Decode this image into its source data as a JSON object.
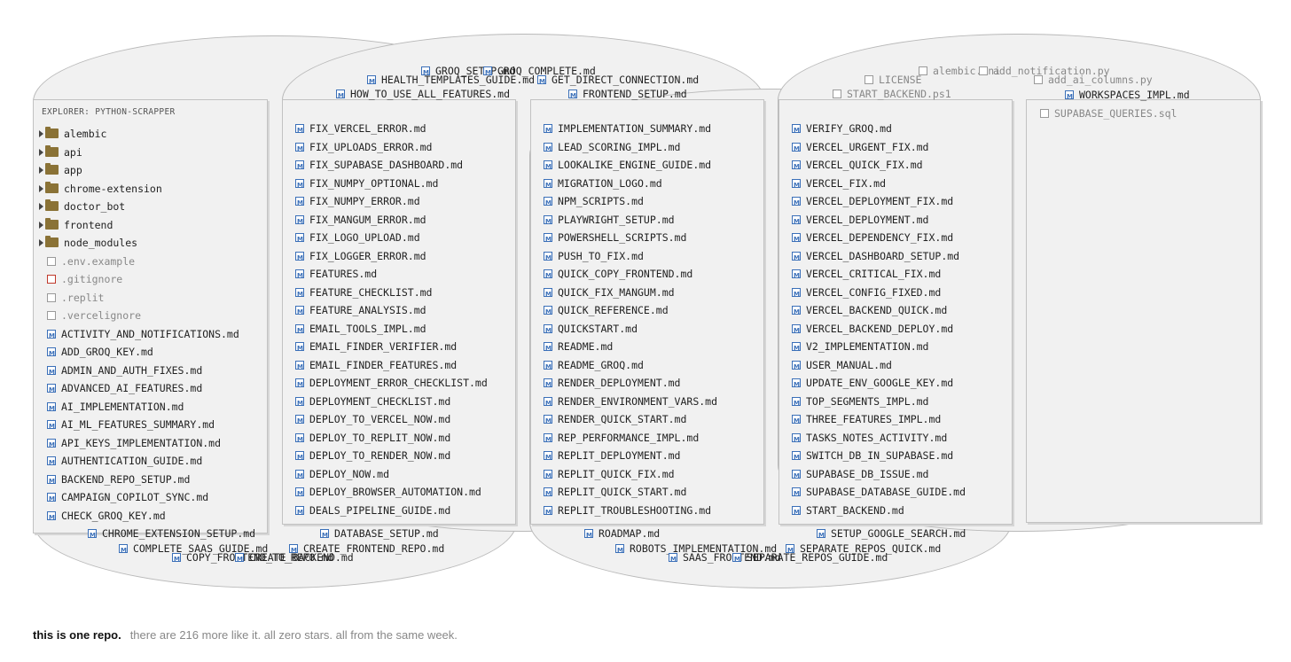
{
  "explorer": {
    "title": "EXPLORER: PYTHON-SCRAPPER",
    "entries": [
      {
        "t": "folder",
        "label": "alembic"
      },
      {
        "t": "folder",
        "label": "api"
      },
      {
        "t": "folder",
        "label": "app"
      },
      {
        "t": "folder",
        "label": "chrome-extension"
      },
      {
        "t": "folder",
        "label": "doctor_bot"
      },
      {
        "t": "folder",
        "label": "frontend"
      },
      {
        "t": "folder",
        "label": "node_modules"
      },
      {
        "t": "file",
        "label": ".env.example"
      },
      {
        "t": "red",
        "label": ".gitignore"
      },
      {
        "t": "file",
        "label": ".replit"
      },
      {
        "t": "file",
        "label": ".vercelignore"
      },
      {
        "t": "md",
        "label": "ACTIVITY_AND_NOTIFICATIONS.md"
      },
      {
        "t": "md",
        "label": "ADD_GROQ_KEY.md"
      },
      {
        "t": "md",
        "label": "ADMIN_AND_AUTH_FIXES.md"
      },
      {
        "t": "md",
        "label": "ADVANCED_AI_FEATURES.md"
      },
      {
        "t": "md",
        "label": "AI_IMPLEMENTATION.md"
      },
      {
        "t": "md",
        "label": "AI_ML_FEATURES_SUMMARY.md"
      },
      {
        "t": "md",
        "label": "API_KEYS_IMPLEMENTATION.md"
      },
      {
        "t": "md",
        "label": "AUTHENTICATION_GUIDE.md"
      },
      {
        "t": "md",
        "label": "BACKEND_REPO_SETUP.md"
      },
      {
        "t": "md",
        "label": "CAMPAIGN_COPILOT_SYNC.md"
      },
      {
        "t": "md",
        "label": "CHECK_GROQ_KEY.md"
      }
    ]
  },
  "col2": [
    "FIX_VERCEL_ERROR.md",
    "FIX_UPLOADS_ERROR.md",
    "FIX_SUPABASE_DASHBOARD.md",
    "FIX_NUMPY_OPTIONAL.md",
    "FIX_NUMPY_ERROR.md",
    "FIX_MANGUM_ERROR.md",
    "FIX_LOGO_UPLOAD.md",
    "FIX_LOGGER_ERROR.md",
    "FEATURES.md",
    "FEATURE_CHECKLIST.md",
    "FEATURE_ANALYSIS.md",
    "EMAIL_TOOLS_IMPL.md",
    "EMAIL_FINDER_VERIFIER.md",
    "EMAIL_FINDER_FEATURES.md",
    "DEPLOYMENT_ERROR_CHECKLIST.md",
    "DEPLOYMENT_CHECKLIST.md",
    "DEPLOY_TO_VERCEL_NOW.md",
    "DEPLOY_TO_REPLIT_NOW.md",
    "DEPLOY_TO_RENDER_NOW.md",
    "DEPLOY_NOW.md",
    "DEPLOY_BROWSER_AUTOMATION.md",
    "DEALS_PIPELINE_GUIDE.md"
  ],
  "col3": [
    "IMPLEMENTATION_SUMMARY.md",
    "LEAD_SCORING_IMPL.md",
    "LOOKALIKE_ENGINE_GUIDE.md",
    "MIGRATION_LOGO.md",
    "NPM_SCRIPTS.md",
    "PLAYWRIGHT_SETUP.md",
    "POWERSHELL_SCRIPTS.md",
    "PUSH_TO_FIX.md",
    "QUICK_COPY_FRONTEND.md",
    "QUICK_FIX_MANGUM.md",
    "QUICK_REFERENCE.md",
    "QUICKSTART.md",
    "README.md",
    "README_GROQ.md",
    "RENDER_DEPLOYMENT.md",
    "RENDER_ENVIRONMENT_VARS.md",
    "RENDER_QUICK_START.md",
    "REP_PERFORMANCE_IMPL.md",
    "REPLIT_DEPLOYMENT.md",
    "REPLIT_QUICK_FIX.md",
    "REPLIT_QUICK_START.md",
    "REPLIT_TROUBLESHOOTING.md"
  ],
  "col4": [
    "VERIFY_GROQ.md",
    "VERCEL_URGENT_FIX.md",
    "VERCEL_QUICK_FIX.md",
    "VERCEL_FIX.md",
    "VERCEL_DEPLOYMENT_FIX.md",
    "VERCEL_DEPLOYMENT.md",
    "VERCEL_DEPENDENCY_FIX.md",
    "VERCEL_DASHBOARD_SETUP.md",
    "VERCEL_CRITICAL_FIX.md",
    "VERCEL_CONFIG_FIXED.md",
    "VERCEL_BACKEND_QUICK.md",
    "VERCEL_BACKEND_DEPLOY.md",
    "V2_IMPLEMENTATION.md",
    "USER_MANUAL.md",
    "UPDATE_ENV_GOOGLE_KEY.md",
    "TOP_SEGMENTS_IMPL.md",
    "THREE_FEATURES_IMPL.md",
    "TASKS_NOTES_ACTIVITY.md",
    "SWITCH_DB_IN_SUPABASE.md",
    "SUPABASE_DB_ISSUE.md",
    "SUPABASE_DATABASE_GUIDE.md",
    "START_BACKEND.md"
  ],
  "col5": [
    {
      "t": "md",
      "label": "WORKSPACES_IMPL.md"
    },
    {
      "t": "file",
      "label": "SUPABASE_QUERIES.sql"
    }
  ],
  "overflow": [
    {
      "t": "md",
      "label": "HEALTH_TEMPLATES_GUIDE.md"
    },
    {
      "t": "md",
      "label": "GROQ_SETUP.md"
    },
    {
      "t": "md",
      "label": "GROQ_COMPLETE.md"
    },
    {
      "t": "md",
      "label": "GET_DIRECT_CONNECTION.md"
    },
    {
      "t": "md",
      "label": "HOW_TO_USE_ALL_FEATURES.md"
    },
    {
      "t": "md",
      "label": "FRONTEND_SETUP.md"
    },
    {
      "t": "file",
      "label": "LICENSE"
    },
    {
      "t": "file",
      "label": "alembic.ini"
    },
    {
      "t": "file",
      "label": "add_notification.py"
    },
    {
      "t": "file",
      "label": "add_ai_columns.py"
    },
    {
      "t": "file",
      "label": "START_BACKEND.ps1"
    },
    {
      "t": "md",
      "label": "CHROME_EXTENSION_SETUP.md"
    },
    {
      "t": "md",
      "label": "DATABASE_SETUP.md"
    },
    {
      "t": "md",
      "label": "COMPLETE_SAAS_GUIDE.md"
    },
    {
      "t": "md",
      "label": "CREATE_FRONTEND_REPO.md"
    },
    {
      "t": "md",
      "label": "COPY_FRONTEND_TO_REPO.md"
    },
    {
      "t": "md",
      "label": "CREATE_BACKEND.md"
    },
    {
      "t": "md",
      "label": "ROADMAP.md"
    },
    {
      "t": "md",
      "label": "ROBOTS_IMPLEMENTATION.md"
    },
    {
      "t": "md",
      "label": "SEPARATE_REPOS_QUICK.md"
    },
    {
      "t": "md",
      "label": "SAAS_FRONTEND.md"
    },
    {
      "t": "md",
      "label": "SEPARATE_REPOS_GUIDE.md"
    },
    {
      "t": "md",
      "label": "SETUP_GOOGLE_SEARCH.md"
    }
  ],
  "caption": {
    "bold": "this is one repo.",
    "rest": "there are 216 more like it. all zero stars. all from the same week."
  }
}
